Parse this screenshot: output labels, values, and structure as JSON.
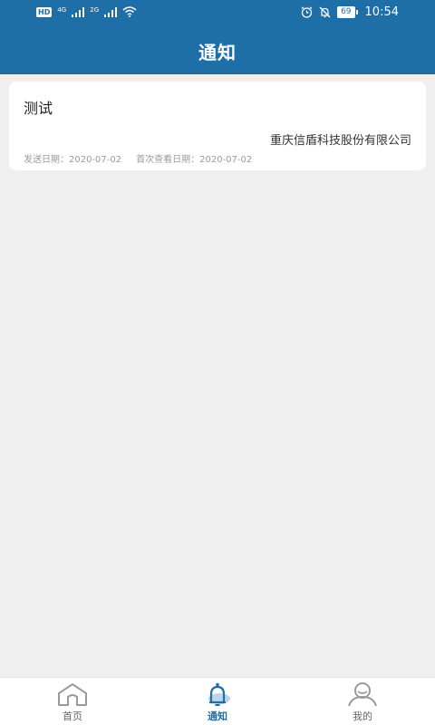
{
  "status_bar": {
    "hd": "HD",
    "net1": "4G",
    "net2": "2G",
    "battery": "69",
    "time": "10:54"
  },
  "header": {
    "title": "通知"
  },
  "notifications": [
    {
      "title": "测试",
      "company": "重庆信盾科技股份有限公司",
      "sent_date": "发送日期：2020-07-02",
      "first_view_date": "首次查看日期：2020-07-02"
    }
  ],
  "tabbar": {
    "tabs": [
      {
        "label": "首页",
        "icon": "home-icon",
        "active": false
      },
      {
        "label": "通知",
        "icon": "bell-icon",
        "active": true
      },
      {
        "label": "我的",
        "icon": "user-icon",
        "active": false
      }
    ]
  },
  "colors": {
    "primary": "#1e6ea8",
    "background": "#efefef"
  }
}
